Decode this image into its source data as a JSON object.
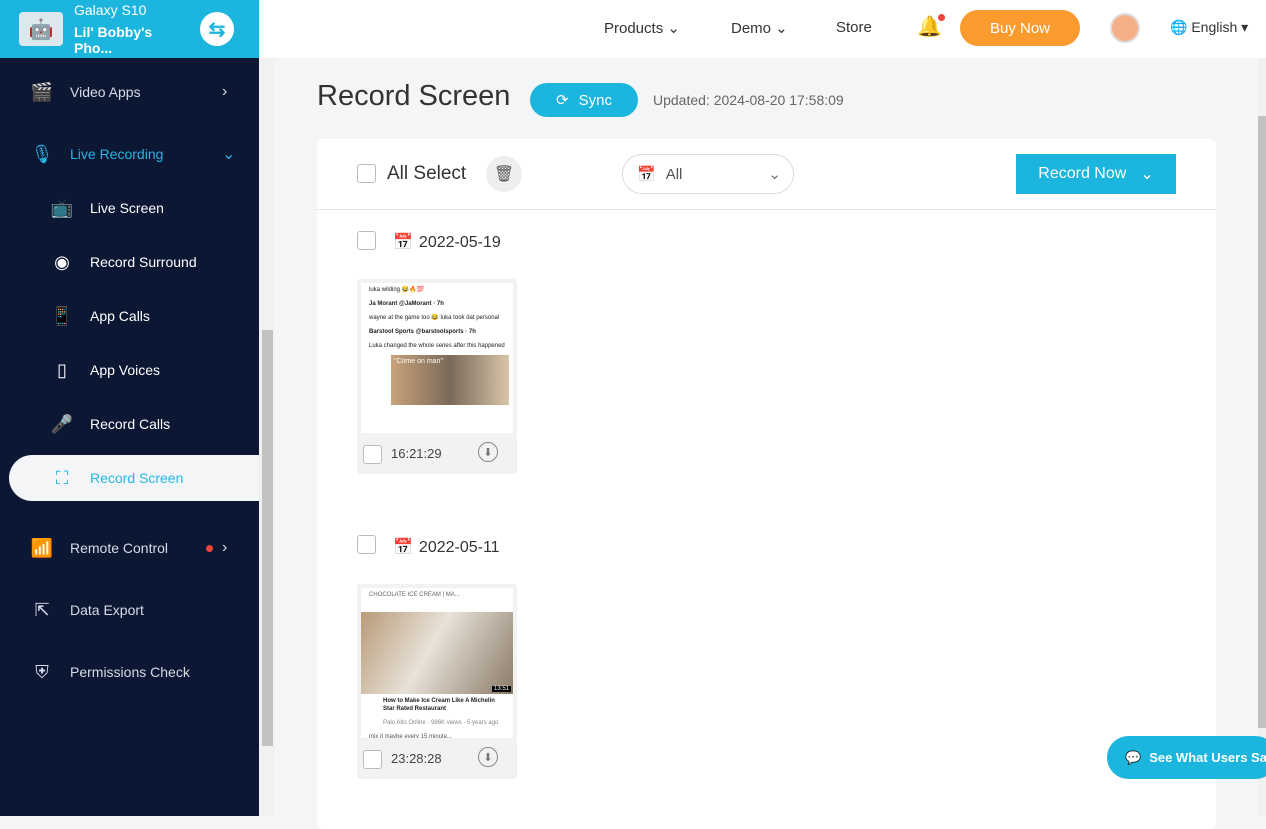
{
  "device": {
    "model": "Galaxy S10",
    "name": "Lil' Bobby's Pho..."
  },
  "sidebar": {
    "items": [
      {
        "label": "Video Apps",
        "icon": "video-clapper-icon"
      },
      {
        "label": "Live Recording",
        "icon": "microphone-icon"
      },
      {
        "label": "Live Screen",
        "icon": "tv-icon"
      },
      {
        "label": "Record Surround",
        "icon": "surround-icon"
      },
      {
        "label": "App Calls",
        "icon": "phone-icon"
      },
      {
        "label": "App Voices",
        "icon": "voice-icon"
      },
      {
        "label": "Record Calls",
        "icon": "mic-icon"
      },
      {
        "label": "Record Screen",
        "icon": "screen-record-icon"
      },
      {
        "label": "Remote Control",
        "icon": "remote-icon"
      },
      {
        "label": "Data Export",
        "icon": "export-icon"
      },
      {
        "label": "Permissions Check",
        "icon": "shield-icon"
      }
    ]
  },
  "topnav": {
    "products": "Products",
    "demo": "Demo",
    "store": "Store",
    "buy": "Buy Now",
    "language": "English"
  },
  "page": {
    "title": "Record Screen",
    "sync": "Sync",
    "updated": "Updated: 2024-08-20 17:58:09"
  },
  "toolbar": {
    "all_select": "All Select",
    "filter": "All",
    "record_now": "Record Now"
  },
  "groups": [
    {
      "date": "2022-05-19",
      "items": [
        {
          "time": "16:21:29",
          "preview": {
            "l1": "luka wilding 😂🔥💯",
            "l2": "Ja Morant @JaMorant · 7h",
            "l3": "wayne at the game too 😂 luka took dat personal",
            "l4": "Barstool Sports @barstoolsports · 7h",
            "l5": "Luka changed the whole series after this happened",
            "l6": "\"Come on man\""
          }
        }
      ]
    },
    {
      "date": "2022-05-11",
      "items": [
        {
          "time": "23:28:28",
          "preview": {
            "l1": "CHOCOLATE ICE CREAM | MA...",
            "l2": "How to Make Ice Cream Like A Michelin Star Rated Restaurant",
            "l3": "Palo Alto Online · 986K views · 5 years ago",
            "l4": "mix it maybe every 15 minute...",
            "l5": "13:51"
          }
        }
      ]
    }
  ],
  "chat": "See What Users Say",
  "colors": {
    "accent": "#1cb5de",
    "buy": "#fb9a2d",
    "sidebar": "#0c1734"
  }
}
